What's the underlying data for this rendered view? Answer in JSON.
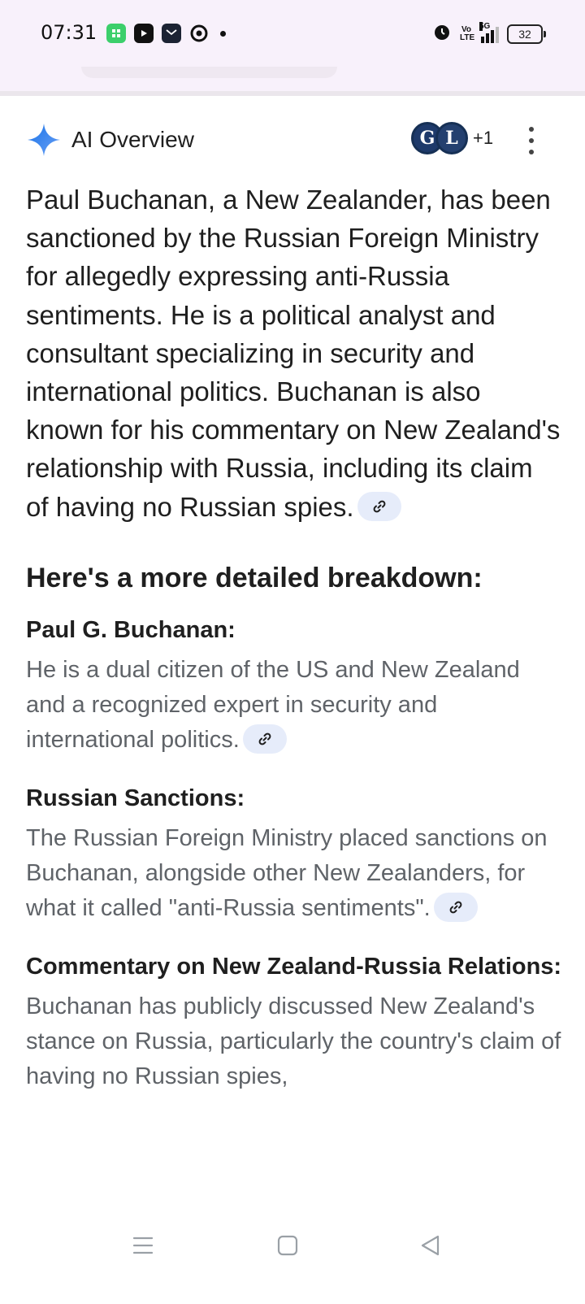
{
  "status_bar": {
    "time": "07:31",
    "battery": "32",
    "network": "5G",
    "volte": "Vo LTE",
    "app_icons": [
      "app-icon",
      "youtube-icon",
      "mail-icon",
      "chrome-icon"
    ]
  },
  "ai_overview": {
    "title": "AI Overview",
    "source_avatars": [
      "G",
      "L"
    ],
    "source_count": "+1"
  },
  "summary": "Paul Buchanan, a New Zealander, has been sanctioned by the Russian Foreign Ministry for allegedly expressing anti-Russia sentiments. He is a political analyst and consultant specializing in security and international politics. Buchanan is also known for his commentary on New Zealand's relationship with Russia, including its claim of having no Russian spies.",
  "breakdown": {
    "title": "Here's a more detailed breakdown:",
    "items": [
      {
        "title": "Paul G. Buchanan:",
        "body": "He is a dual citizen of the US and New Zealand and a recognized expert in security and international politics."
      },
      {
        "title": "Russian Sanctions:",
        "body": "The Russian Foreign Ministry placed sanctions on Buchanan, alongside other New Zealanders, for what it called \"anti-Russia sentiments\"."
      },
      {
        "title": "Commentary on New Zealand-Russia Relations:",
        "body": "Buchanan has publicly discussed New Zealand's stance on Russia, particularly the country's claim of having no Russian spies,"
      }
    ]
  },
  "colors": {
    "status_bg": "#f8f1fb",
    "accent_blue": "#4285f4",
    "chip_bg": "#e6ecfa",
    "body_gray": "#5f6368"
  }
}
